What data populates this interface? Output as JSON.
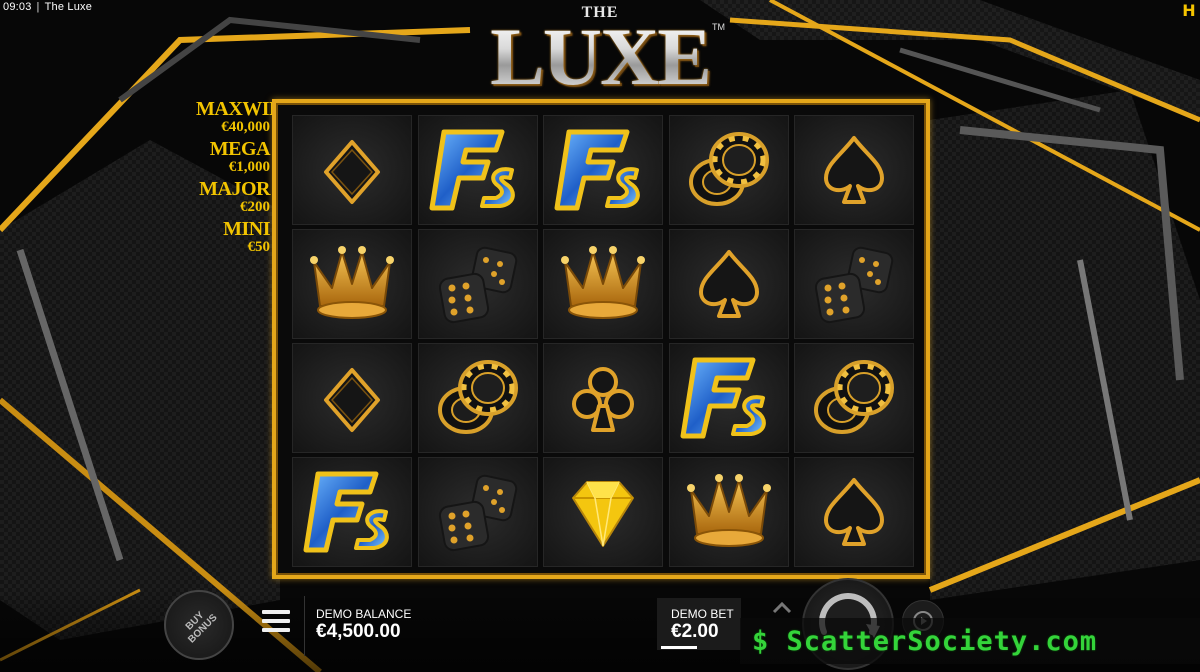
{
  "status_bar": {
    "time": "09:03",
    "separator": "|",
    "game_name": "The Luxe",
    "brand_badge": "H"
  },
  "logo": {
    "prefix": "THE",
    "title": "LUXE",
    "trademark": "TM"
  },
  "jackpots": [
    {
      "name": "MAXWIN",
      "value": "€40,000"
    },
    {
      "name": "MEGA",
      "value": "€1,000"
    },
    {
      "name": "MAJOR",
      "value": "€200"
    },
    {
      "name": "MINI",
      "value": "€50"
    }
  ],
  "reels": [
    [
      "diamond-suit",
      "free-spins",
      "free-spins",
      "poker-chips",
      "spade-suit"
    ],
    [
      "crown",
      "dice",
      "crown",
      "spade-suit",
      "dice"
    ],
    [
      "diamond-suit",
      "poker-chips",
      "club-suit",
      "free-spins",
      "poker-chips"
    ],
    [
      "free-spins",
      "dice",
      "gem",
      "crown",
      "spade-suit"
    ]
  ],
  "controls": {
    "buy_bonus_label": "BUY BONUS",
    "balance_label": "DEMO BALANCE",
    "balance_value": "€4,500.00",
    "bet_label": "DEMO BET",
    "bet_value": "€2.00"
  },
  "watermark": {
    "text": "$ ScatterSociety.com"
  },
  "colors": {
    "gold": "#e5a71a",
    "jackpot_text": "#f2c400",
    "background": "#0c0c0c",
    "watermark": "#34d43a"
  }
}
